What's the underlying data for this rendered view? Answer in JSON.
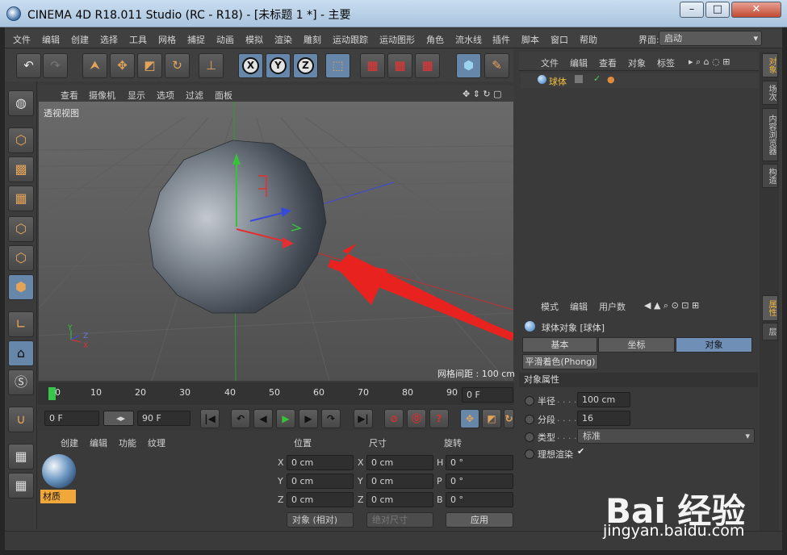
{
  "window": {
    "title": "CINEMA 4D R18.011 Studio (RC - R18) - [未标题 1 *] - 主要",
    "minimize": "–",
    "maximize": "□",
    "close": "✕"
  },
  "menubar": {
    "items": [
      "文件",
      "编辑",
      "创建",
      "选择",
      "工具",
      "网格",
      "捕捉",
      "动画",
      "模拟",
      "渲染",
      "雕刻",
      "运动跟踪",
      "运动图形",
      "角色",
      "流水线",
      "插件",
      "脚本",
      "窗口",
      "帮助"
    ],
    "layout_label": "界面:",
    "layout_value": "启动"
  },
  "toolbar": {
    "undo_icon": "undo-icon",
    "axis_labels": [
      "X",
      "Y",
      "Z"
    ]
  },
  "viewport": {
    "menu": [
      "查看",
      "摄像机",
      "显示",
      "选项",
      "过滤",
      "面板"
    ],
    "label": "透视视图",
    "grid_spacing": "网格间距 : 100 cm",
    "axis_x": "X",
    "axis_y": "Y",
    "axis_z": "Z",
    "colors": {
      "x_axis": "#e23030",
      "y_axis": "#38c23a",
      "z_axis": "#3a4ad8",
      "arrow": "#e8231f"
    }
  },
  "timeline": {
    "ticks": [
      "0",
      "10",
      "20",
      "30",
      "40",
      "50",
      "60",
      "70",
      "80",
      "90"
    ],
    "current_frame": "0 F"
  },
  "transport": {
    "start_frame": "0 F",
    "end_frame": "90 F"
  },
  "material_manager": {
    "menu": [
      "创建",
      "编辑",
      "功能",
      "纹理"
    ],
    "material_name": "材质"
  },
  "coordinates": {
    "headers": [
      "位置",
      "尺寸",
      "旋转"
    ],
    "rows": [
      {
        "p_label": "X",
        "p_value": "0 cm",
        "s_label": "X",
        "s_value": "0 cm",
        "r_label": "H",
        "r_value": "0 °"
      },
      {
        "p_label": "Y",
        "p_value": "0 cm",
        "s_label": "Y",
        "s_value": "0 cm",
        "r_label": "P",
        "r_value": "0 °"
      },
      {
        "p_label": "Z",
        "p_value": "0 cm",
        "s_label": "Z",
        "s_value": "0 cm",
        "r_label": "B",
        "r_value": "0 °"
      }
    ],
    "mode_dropdown": "对象 (相对)",
    "size_dropdown": "绝对尺寸",
    "apply_button": "应用"
  },
  "object_manager": {
    "menu": [
      "文件",
      "编辑",
      "查看",
      "对象",
      "标签"
    ],
    "object_name": "球体"
  },
  "attribute_manager": {
    "menu": [
      "模式",
      "编辑",
      "用户数"
    ],
    "object_title": "球体对象 [球体]",
    "tabs": [
      "基本",
      "坐标",
      "对象"
    ],
    "phong_tab": "平滑着色(Phong)",
    "section": "对象属性",
    "props": [
      {
        "label": "半径",
        "value": "100 cm"
      },
      {
        "label": "分段",
        "value": "16"
      },
      {
        "label": "类型",
        "value": "标准"
      },
      {
        "label": "理想渲染",
        "value": "✔"
      }
    ]
  },
  "side_tabs": [
    "对象",
    "场次",
    "内容浏览器",
    "构造",
    "属性",
    "层"
  ],
  "watermark": {
    "brand": "Bai 经验",
    "url": "jingyan.baidu.com"
  }
}
